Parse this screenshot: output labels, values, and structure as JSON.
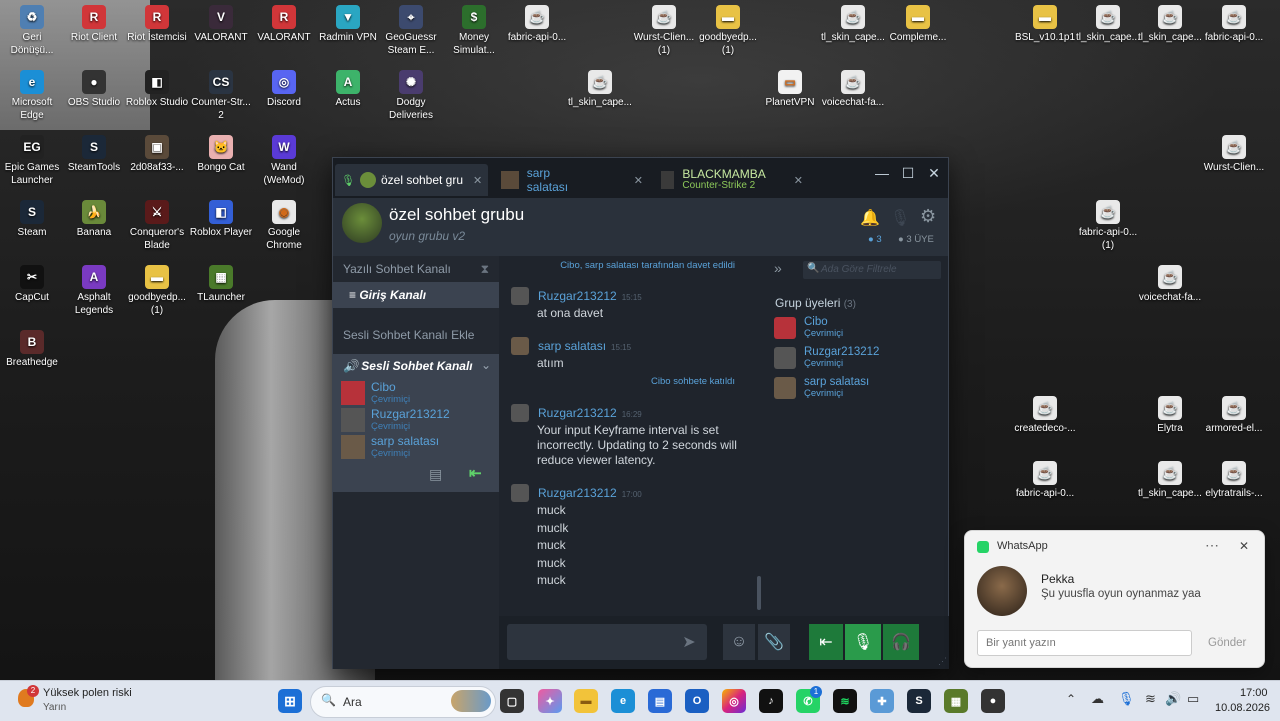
{
  "desktop_icons": [
    {
      "label": "Geri Dönüşü...",
      "color": "#4f7fb2",
      "glyph": "♻",
      "x": 0
    },
    {
      "label": "Riot Client",
      "color": "#d13639",
      "glyph": "R",
      "x": 1
    },
    {
      "label": "Riot İstemcisi",
      "color": "#d13639",
      "glyph": "R",
      "x": 2
    },
    {
      "label": "VALORANT",
      "color": "#3a2a3a",
      "glyph": "V",
      "x": 3
    },
    {
      "label": "VALORANT",
      "color": "#d13639",
      "glyph": "R",
      "x": 4
    },
    {
      "label": "Radmin VPN",
      "color": "#2aa6c2",
      "glyph": "▼",
      "x": 5
    },
    {
      "label": "GeoGuessr Steam E...",
      "color": "#3c4a6e",
      "glyph": "⌖",
      "x": 6
    },
    {
      "label": "Money Simulat...",
      "color": "#2c6e2c",
      "glyph": "$",
      "x": 7
    },
    {
      "label": "fabric-api-0...",
      "color": "#e9e9e9",
      "glyph": "☕",
      "x": 8
    },
    {
      "label": "Wurst-Clien... (1)",
      "color": "#e9e9e9",
      "glyph": "☕",
      "x": 10
    },
    {
      "label": "goodbyedp... (1)",
      "color": "#e8c245",
      "glyph": "▬",
      "x": 11
    },
    {
      "label": "tl_skin_cape...",
      "color": "#e9e9e9",
      "glyph": "☕",
      "x": 13
    },
    {
      "label": "Compleme...",
      "color": "#e8c245",
      "glyph": "▬",
      "x": 14
    },
    {
      "label": "BSL_v10.1p1",
      "color": "#e8c245",
      "glyph": "▬",
      "x": 16
    },
    {
      "label": "tl_skin_cape...",
      "color": "#e9e9e9",
      "glyph": "☕",
      "x": 17
    },
    {
      "label": "tl_skin_cape...",
      "color": "#e9e9e9",
      "glyph": "☕",
      "x": 18
    },
    {
      "label": "fabric-api-0...",
      "color": "#e9e9e9",
      "glyph": "☕",
      "x": 19
    }
  ],
  "desktop_icons_row2": [
    {
      "label": "Microsoft Edge",
      "color": "#1b8fd6",
      "glyph": "e"
    },
    {
      "label": "OBS Studio",
      "color": "#333",
      "glyph": "●"
    },
    {
      "label": "Roblox Studio",
      "color": "#222",
      "glyph": "◧"
    },
    {
      "label": "Counter-Str... 2",
      "color": "#2a3442",
      "glyph": "CS"
    },
    {
      "label": "Discord",
      "color": "#5865f2",
      "glyph": "◎"
    },
    {
      "label": "Actus",
      "color": "#3db36a",
      "glyph": "A"
    },
    {
      "label": "Dodgy Deliveries",
      "color": "#4a3c6e",
      "glyph": "✺"
    },
    {
      "label": "tl_skin_cape...",
      "color": "#e9e9e9",
      "glyph": "☕"
    },
    {
      "label": "PlanetVPN",
      "color": "#f2f2f2",
      "glyph": "▭"
    },
    {
      "label": "voicechat-fa...",
      "color": "#e9e9e9",
      "glyph": "☕"
    }
  ],
  "desktop_col1": [
    {
      "label": "Epic Games Launcher",
      "color": "#222",
      "glyph": "EG"
    },
    {
      "label": "Steam",
      "color": "#1b2838",
      "glyph": "S"
    },
    {
      "label": "CapCut",
      "color": "#111",
      "glyph": "✂"
    },
    {
      "label": "Breathedge",
      "color": "#5a2a2a",
      "glyph": "B"
    }
  ],
  "desktop_col2": [
    {
      "label": "SteamTools",
      "color": "#1b2838",
      "glyph": "S"
    },
    {
      "label": "Banana",
      "color": "#6a8a3a",
      "glyph": "🍌"
    },
    {
      "label": "Asphalt Legends",
      "color": "#7a3ac2",
      "glyph": "A"
    }
  ],
  "desktop_col3": [
    {
      "label": "2d08af33-...",
      "color": "#5a4a3a",
      "glyph": "▣"
    },
    {
      "label": "Conqueror's Blade",
      "color": "#5a1a1a",
      "glyph": "⚔"
    },
    {
      "label": "goodbyedp... (1)",
      "color": "#e8c245",
      "glyph": "▬"
    }
  ],
  "desktop_col4": [
    {
      "label": "Bongo Cat",
      "color": "#e9b0b0",
      "glyph": "🐱"
    },
    {
      "label": "Roblox Player",
      "color": "#335fd6",
      "glyph": "◧"
    },
    {
      "label": "TLauncher",
      "color": "#4a7a2a",
      "glyph": "▦"
    }
  ],
  "desktop_col5": [
    {
      "label": "Wand (WeMod)",
      "color": "#5a3ad6",
      "glyph": "W"
    },
    {
      "label": "Google Chrome",
      "color": "#e9e9e9",
      "glyph": "◉"
    }
  ],
  "desktop_right": [
    {
      "label": "Wurst-Clien...",
      "color": "#e9e9e9",
      "glyph": "☕"
    },
    {
      "label": "fabric-api-0... (1)",
      "color": "#e9e9e9",
      "glyph": "☕"
    },
    {
      "label": "voicechat-fa...",
      "color": "#e9e9e9",
      "glyph": "☕"
    },
    {
      "label": "createdeco-...",
      "color": "#e9e9e9",
      "glyph": "☕"
    },
    {
      "label": "Elytra",
      "color": "#e9e9e9",
      "glyph": "☕"
    },
    {
      "label": "armored-el...",
      "color": "#e9e9e9",
      "glyph": "☕"
    },
    {
      "label": "fabric-api-0...",
      "color": "#e9e9e9",
      "glyph": "☕"
    },
    {
      "label": "tl_skin_cape...",
      "color": "#e9e9e9",
      "glyph": "☕"
    },
    {
      "label": "elytratrails-...",
      "color": "#e9e9e9",
      "glyph": "☕"
    }
  ],
  "steam": {
    "tabs": [
      {
        "label": "özel sohbet gru"
      },
      {
        "label": "sarp salatası"
      },
      {
        "label": "BLACKMAMBA",
        "sub": "Counter-Strike 2"
      }
    ],
    "header": {
      "group_name": "özel sohbet grubu",
      "group_sub": "oyun grubu v2",
      "voice_count": "3",
      "member_count": "3 ÜYE"
    },
    "left": {
      "text_channel_header": "Yazılı Sohbet Kanalı",
      "entry_channel": "Giriş Kanalı",
      "add_voice": "Sesli Sohbet Kanalı Ekle",
      "voice_channel": "Sesli Sohbet Kanalı",
      "voice_users": [
        {
          "name": "Cibo",
          "status": "Çevrimiçi"
        },
        {
          "name": "Ruzgar213212",
          "status": "Çevrimiçi"
        },
        {
          "name": "sarp salatası",
          "status": "Çevrimiçi"
        }
      ]
    },
    "chat": {
      "sys_invite": "Cibo, sarp salatası tarafından davet edildi",
      "sys_joined": "Cibo sohbete katıldı",
      "messages": [
        {
          "name": "Ruzgar213212",
          "time": "15:15",
          "text": "at ona davet"
        },
        {
          "name": "sarp salatası",
          "time": "15:15",
          "text": "atıım"
        },
        {
          "name": "Ruzgar213212",
          "time": "16:29",
          "text": "Your input Keyframe interval is set incorrectly. Updating to 2 seconds will reduce viewer latency."
        },
        {
          "name": "Ruzgar213212",
          "time": "17:00",
          "lines": [
            "muck",
            "muclk",
            "muck",
            "muck",
            "muck"
          ]
        }
      ]
    },
    "members": {
      "filter_placeholder": "Ada Göre Filtrele",
      "title": "Grup üyeleri",
      "count": "(3)",
      "list": [
        {
          "name": "Cibo",
          "status": "Çevrimiçi"
        },
        {
          "name": "Ruzgar213212",
          "status": "Çevrimiçi"
        },
        {
          "name": "sarp salatası",
          "status": "Çevrimiçi"
        }
      ]
    }
  },
  "whatsapp": {
    "app": "WhatsApp",
    "sender": "Pekka",
    "message": "Şu yuusfla oyun oynanmaz yaa",
    "reply_placeholder": "Bir yanıt yazın",
    "send_label": "Gönder"
  },
  "taskbar": {
    "weather_title": "Yüksek polen riski",
    "weather_sub": "Yarın",
    "weather_badge": "2",
    "search_placeholder": "Ara",
    "time": "17:00",
    "date": "10.08.2026",
    "wa_badge": "1"
  }
}
